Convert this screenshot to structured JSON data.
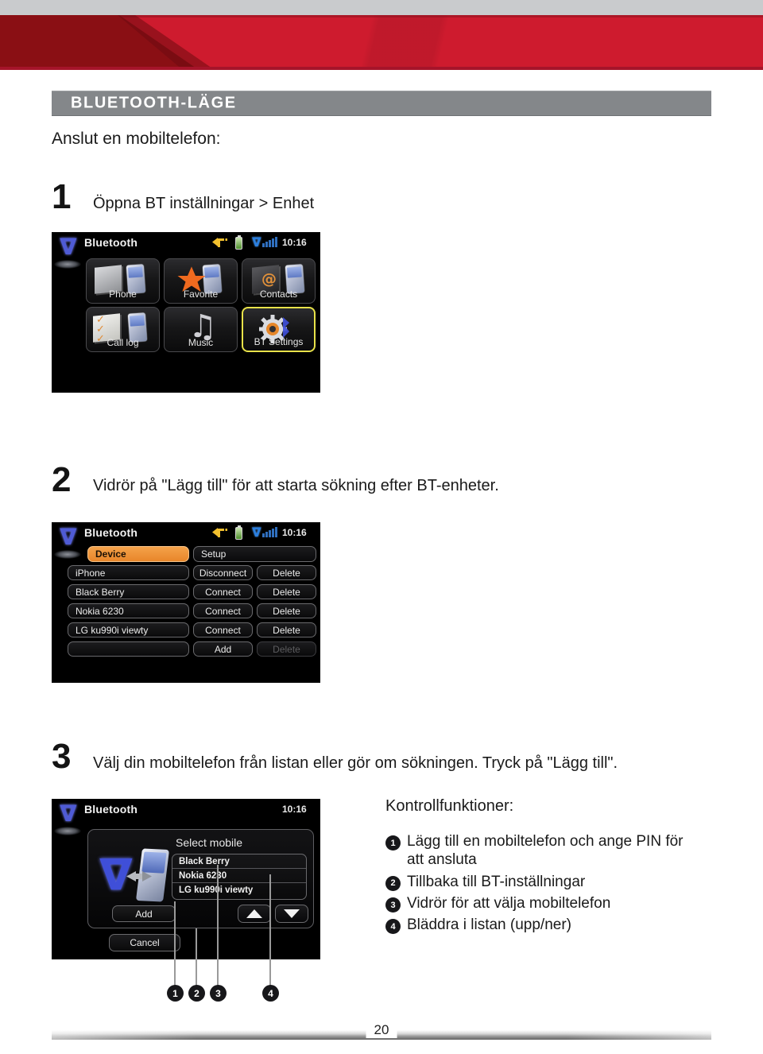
{
  "document": {
    "page_number": "20",
    "section_title": "BLUETOOTH-LÄGE",
    "intro": "Anslut en mobiltelefon:",
    "accent_red": "#CE1B2E",
    "accent_dark_red": "#8A0F14",
    "header_gray": "#84878A"
  },
  "steps": [
    {
      "number": "1",
      "text": "Öppna BT inställningar > Enhet"
    },
    {
      "number": "2",
      "text": "Vidrör på \"Lägg till\" för att starta sökning efter BT-enheter."
    },
    {
      "number": "3",
      "text": "Välj din mobiltelefon från listan eller gör om sökningen. Tryck på \"Lägg till\"."
    }
  ],
  "screen1": {
    "title": "Bluetooth",
    "clock": "10:16",
    "status_icons": [
      "navigation-icon",
      "battery-icon",
      "bluetooth-icon",
      "signal-bars-icon"
    ],
    "tiles": [
      {
        "label": "Phone",
        "icon": "phone-keypad-icon",
        "selected": false
      },
      {
        "label": "Favorite",
        "icon": "star-icon",
        "selected": false
      },
      {
        "label": "Contacts",
        "icon": "contacts-at-icon",
        "selected": false
      },
      {
        "label": "Call log",
        "icon": "call-log-check-icon",
        "selected": false
      },
      {
        "label": "Music",
        "icon": "music-note-icon",
        "selected": false
      },
      {
        "label": "BT Settings",
        "icon": "gear-bluetooth-icon",
        "selected": true
      }
    ],
    "selected_tile_outline": "#E8E24A"
  },
  "screen2": {
    "title": "Bluetooth",
    "clock": "10:16",
    "tabs": [
      {
        "label": "Device",
        "active": true
      },
      {
        "label": "Setup",
        "active": false
      }
    ],
    "active_tab_color": "#E8862A",
    "rows": [
      {
        "device": "iPhone",
        "action": "Disconnect",
        "delete": "Delete",
        "delete_dim": false
      },
      {
        "device": "Black Berry",
        "action": "Connect",
        "delete": "Delete",
        "delete_dim": false
      },
      {
        "device": "Nokia 6230",
        "action": "Connect",
        "delete": "Delete",
        "delete_dim": false
      },
      {
        "device": "LG ku990i viewty",
        "action": "Connect",
        "delete": "Delete",
        "delete_dim": false
      },
      {
        "device": "",
        "action": "Add",
        "delete": "Delete",
        "delete_dim": true
      }
    ]
  },
  "screen3": {
    "title": "Bluetooth",
    "clock": "10:16",
    "dialog_title": "Select mobile",
    "list": [
      "Black Berry",
      "Nokia 6230",
      "LG ku990i viewty"
    ],
    "add_label": "Add",
    "cancel_label": "Cancel",
    "scroll_up": "scroll-up-icon",
    "scroll_down": "scroll-down-icon"
  },
  "callouts": {
    "markers": [
      "1",
      "2",
      "3",
      "4"
    ]
  },
  "key_functions": {
    "title": "Kontrollfunktioner:",
    "items": [
      {
        "number": "1",
        "text": "Lägg till en mobiltelefon och ange PIN för att ansluta"
      },
      {
        "number": "2",
        "text": "Tillbaka till BT-inställningar"
      },
      {
        "number": "3",
        "text": "Vidrör för att välja mobiltelefon"
      },
      {
        "number": "4",
        "text": "Bläddra i listan (upp/ner)"
      }
    ]
  }
}
